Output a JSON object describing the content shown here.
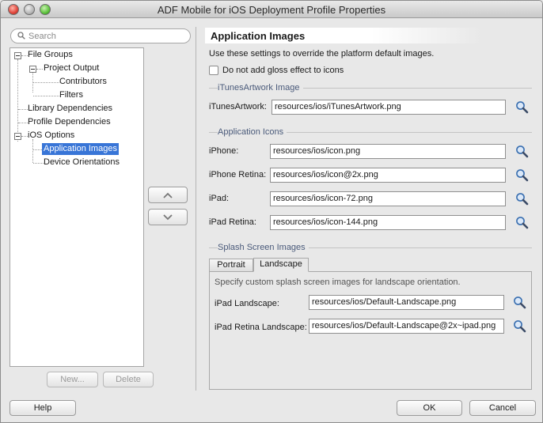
{
  "window": {
    "title": "ADF Mobile for iOS Deployment Profile Properties"
  },
  "search": {
    "placeholder": "Search"
  },
  "tree": {
    "items": [
      {
        "label": "File Groups"
      },
      {
        "label": "Project Output"
      },
      {
        "label": "Contributors"
      },
      {
        "label": "Filters"
      },
      {
        "label": "Library Dependencies"
      },
      {
        "label": "Profile Dependencies"
      },
      {
        "label": "iOS Options"
      },
      {
        "label": "Application Images"
      },
      {
        "label": "Device Orientations"
      }
    ],
    "selected": "Application Images"
  },
  "tree_buttons": {
    "new_label": "New...",
    "delete_label": "Delete"
  },
  "panel": {
    "title": "Application Images",
    "description": "Use these settings to override the platform default images.",
    "gloss_checkbox_label": "Do not add gloss effect to icons",
    "gloss_checked": false,
    "itunes_section": "iTunesArtwork Image",
    "itunes_label": "iTunesArtwork:",
    "itunes_value": "resources/ios/iTunesArtwork.png",
    "icons_section": "Application Icons",
    "icons": [
      {
        "label": "iPhone:",
        "value": "resources/ios/icon.png"
      },
      {
        "label": "iPhone Retina:",
        "value": "resources/ios/icon@2x.png"
      },
      {
        "label": "iPad:",
        "value": "resources/ios/icon-72.png"
      },
      {
        "label": "iPad Retina:",
        "value": "resources/ios/icon-144.png"
      }
    ],
    "splash_section": "Splash Screen Images",
    "tabs": [
      {
        "label": "Portrait"
      },
      {
        "label": "Landscape"
      }
    ],
    "active_tab": "Landscape",
    "splash_description": "Specify custom splash screen images for landscape orientation.",
    "splash": [
      {
        "label": "iPad Landscape:",
        "value": "resources/ios/Default-Landscape.png"
      },
      {
        "label": "iPad Retina Landscape:",
        "value": "resources/ios/Default-Landscape@2x~ipad.png"
      }
    ]
  },
  "footer": {
    "help_label": "Help",
    "ok_label": "OK",
    "cancel_label": "Cancel"
  },
  "colors": {
    "selection": "#3875d7",
    "section_label": "#4a5a7a"
  }
}
